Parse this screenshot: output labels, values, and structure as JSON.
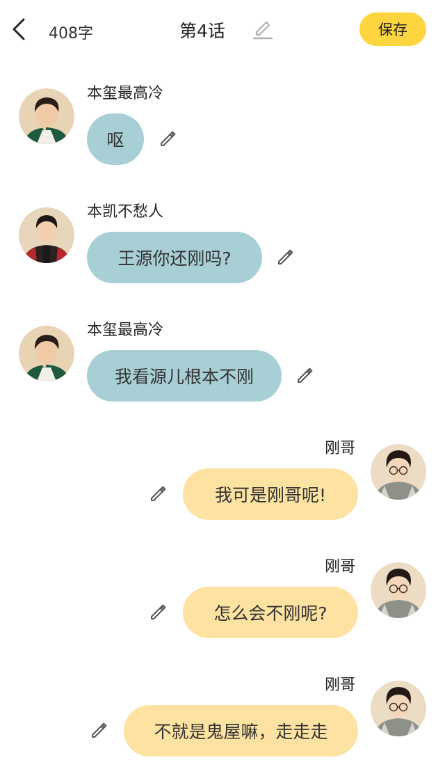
{
  "header": {
    "word_count": "408字",
    "title": "第4话",
    "save_label": "保存"
  },
  "messages": [
    {
      "sender": "本玺最高冷",
      "text": "呕",
      "side": "left"
    },
    {
      "sender": "本凯不愁人",
      "text": "王源你还刚吗?",
      "side": "left"
    },
    {
      "sender": "本玺最高冷",
      "text": "我看源儿根本不刚",
      "side": "left"
    },
    {
      "sender": "刚哥",
      "text": "我可是刚哥呢!",
      "side": "right"
    },
    {
      "sender": "刚哥",
      "text": "怎么会不刚呢?",
      "side": "right"
    },
    {
      "sender": "刚哥",
      "text": "不就是鬼屋嘛，走走走",
      "side": "right"
    }
  ],
  "colors": {
    "accent": "#fdd63f",
    "left_bubble": "#a8cfd6",
    "right_bubble": "#fde2a1"
  }
}
